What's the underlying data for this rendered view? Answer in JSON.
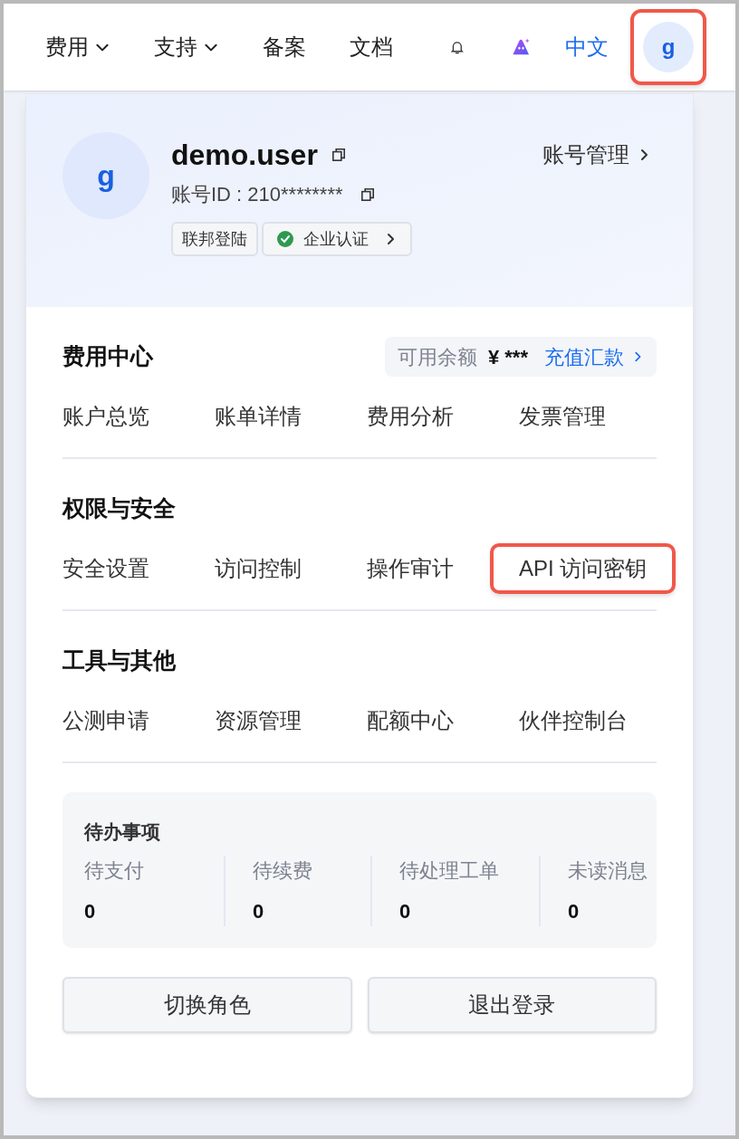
{
  "nav": {
    "items": [
      {
        "label": "费用",
        "dropdown": true
      },
      {
        "label": "支持",
        "dropdown": true
      },
      {
        "label": "备案",
        "dropdown": false
      },
      {
        "label": "文档",
        "dropdown": false
      }
    ],
    "language": "中文",
    "avatar": {
      "letter": "g",
      "highlighted": true
    }
  },
  "profile": {
    "avatar_letter": "g",
    "username": "demo.user",
    "account_id": "账号ID : 210********",
    "manage_link": "账号管理",
    "tags": [
      {
        "label": "联邦登陆",
        "kind": "plain"
      },
      {
        "label": "企业认证",
        "kind": "verified"
      }
    ]
  },
  "sections": [
    {
      "title": "费用中心",
      "balance": {
        "label": "可用余额",
        "value": "¥ ***",
        "link": "充值汇款"
      },
      "links": [
        {
          "label": "账户总览",
          "highlighted": false
        },
        {
          "label": "账单详情",
          "highlighted": false
        },
        {
          "label": "费用分析",
          "highlighted": false
        },
        {
          "label": "发票管理",
          "highlighted": false
        }
      ]
    },
    {
      "title": "权限与安全",
      "links": [
        {
          "label": "安全设置",
          "highlighted": false
        },
        {
          "label": "访问控制",
          "highlighted": false
        },
        {
          "label": "操作审计",
          "highlighted": false
        },
        {
          "label": "API 访问密钥",
          "highlighted": true
        }
      ]
    },
    {
      "title": "工具与其他",
      "links": [
        {
          "label": "公测申请",
          "highlighted": false
        },
        {
          "label": "资源管理",
          "highlighted": false
        },
        {
          "label": "配额中心",
          "highlighted": false
        },
        {
          "label": "伙伴控制台",
          "highlighted": false
        }
      ]
    }
  ],
  "todo": {
    "title": "待办事项",
    "items": [
      {
        "label": "待支付",
        "value": "0"
      },
      {
        "label": "待续费",
        "value": "0"
      },
      {
        "label": "待处理工单",
        "value": "0"
      },
      {
        "label": "未读消息",
        "value": "0"
      }
    ]
  },
  "buttons": [
    "切换角色",
    "退出登录"
  ]
}
